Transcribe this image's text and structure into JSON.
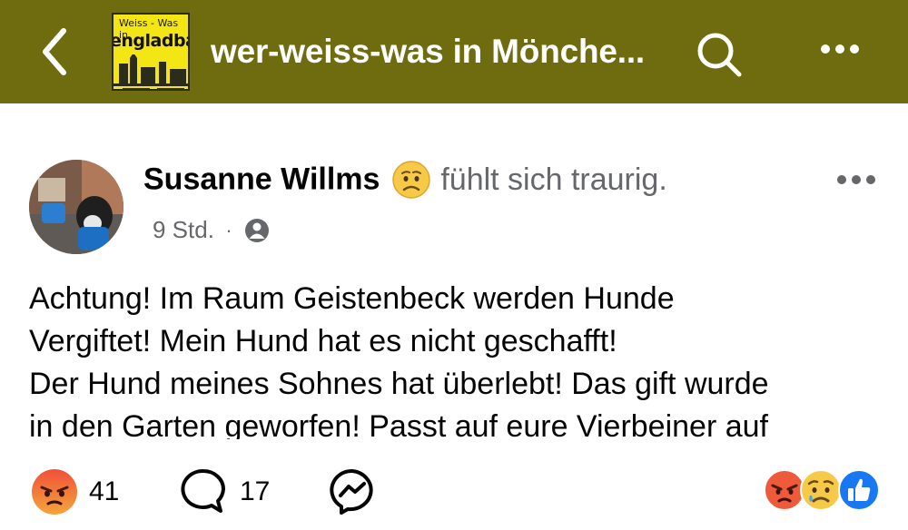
{
  "header": {
    "group_title": "wer-weiss-was in Mönche...",
    "logo_text_top": "Weiss - Was in",
    "logo_text_main": "engladba",
    "bar_color": "#6e6c0f"
  },
  "post": {
    "author": "Susanne Willms",
    "feeling": "fühlt sich traurig.",
    "time": "9 Std.",
    "separator": "·",
    "lines": [
      "Achtung! Im Raum Geistenbeck werden Hunde",
      "Vergiftet! Mein Hund hat es nicht geschafft!",
      "Der Hund meines Sohnes hat überlebt! Das gift wurde",
      "in den Garten geworfen! Passt auf eure Vierbeiner auf"
    ]
  },
  "footer": {
    "reaction_count": "41",
    "comment_count": "17",
    "reaction_icons": [
      "angry-emoji-icon",
      "sad-emoji-icon",
      "like-thumb-icon"
    ]
  },
  "icons": {
    "back": "chevron-left-icon",
    "search": "search-icon",
    "more": "more-horizontal-icon",
    "privacy": "friends-privacy-icon",
    "comment": "comment-bubble-icon",
    "share": "messenger-icon"
  }
}
